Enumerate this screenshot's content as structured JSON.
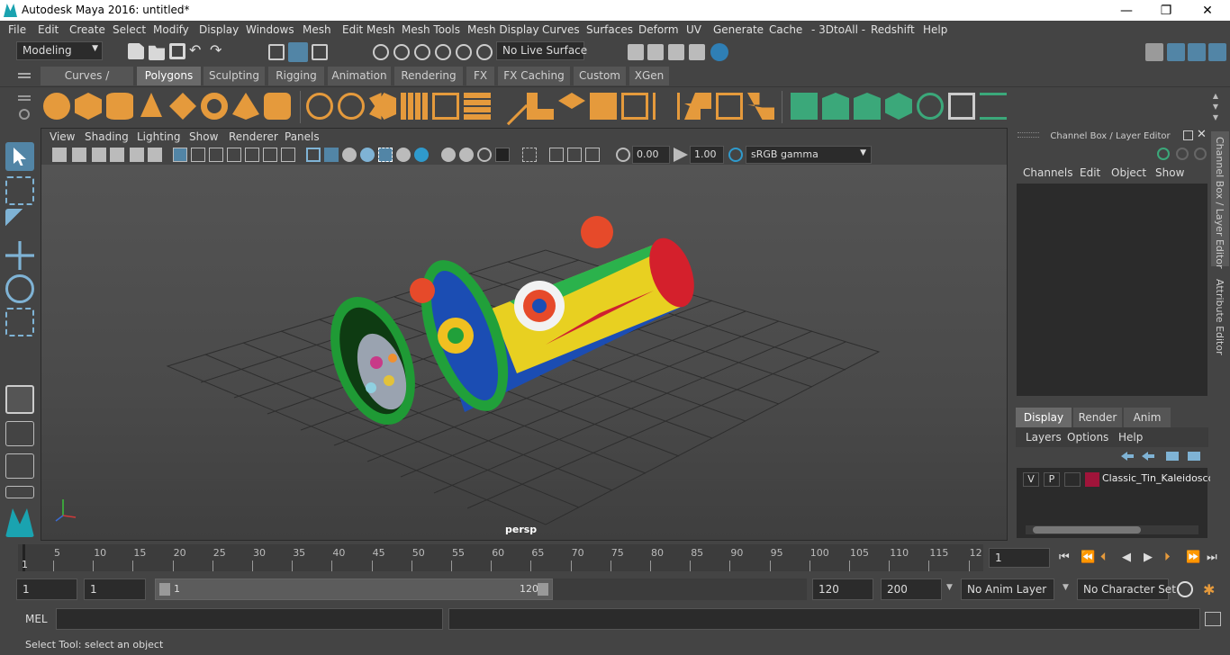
{
  "window": {
    "title": "Autodesk Maya 2016: untitled*",
    "controls": [
      "—",
      "❐",
      "✕"
    ]
  },
  "menubar": [
    "File",
    "Edit",
    "Create",
    "Select",
    "Modify",
    "Display",
    "Windows",
    "Mesh",
    "Edit Mesh",
    "Mesh Tools",
    "Mesh Display",
    "Curves",
    "Surfaces",
    "Deform",
    "UV",
    "Generate",
    "Cache",
    "- 3DtoAll -",
    "Redshift",
    "Help"
  ],
  "statusline": {
    "mode": "Modeling",
    "live_surface": "No Live Surface"
  },
  "shelf_tabs": [
    "Curves / Surfaces",
    "Polygons",
    "Sculpting",
    "Rigging",
    "Animation",
    "Rendering",
    "FX",
    "FX Caching",
    "Custom",
    "XGen"
  ],
  "shelf_active": "Polygons",
  "viewport": {
    "menu": [
      "View",
      "Shading",
      "Lighting",
      "Show",
      "Renderer",
      "Panels"
    ],
    "exposure": "0.00",
    "gamma": "1.00",
    "color_space": "sRGB gamma",
    "camera_label": "persp"
  },
  "channel_box": {
    "title": "Channel Box / Layer Editor",
    "menu": [
      "Channels",
      "Edit",
      "Object",
      "Show"
    ]
  },
  "layer_editor": {
    "tabs": [
      "Display",
      "Render",
      "Anim"
    ],
    "active_tab": "Display",
    "menu": [
      "Layers",
      "Options",
      "Help"
    ],
    "layer": {
      "v": "V",
      "p": "P",
      "name": "Classic_Tin_Kaleidosco",
      "color": "#a0143a"
    }
  },
  "side_tabs": [
    "Channel Box / Layer Editor",
    "Attribute Editor"
  ],
  "timeline": {
    "ticks": [
      "5",
      "10",
      "15",
      "20",
      "25",
      "30",
      "35",
      "40",
      "45",
      "50",
      "55",
      "60",
      "65",
      "70",
      "75",
      "80",
      "85",
      "90",
      "95",
      "100",
      "105",
      "110",
      "115",
      "12"
    ],
    "current_marker": "1",
    "current_frame": "1"
  },
  "range": {
    "start": "1",
    "playback_start": "1",
    "slider_start": "1",
    "slider_end": "120",
    "playback_end": "120",
    "end": "200",
    "anim_layer": "No Anim Layer",
    "character_set": "No Character Set"
  },
  "cmd": {
    "label": "MEL"
  },
  "help_line": "Select Tool: select an object",
  "colors": {
    "accent": "#5285a6",
    "shelf_icon": "#e59a3c",
    "shelf_icon_green": "#3ba87a"
  }
}
